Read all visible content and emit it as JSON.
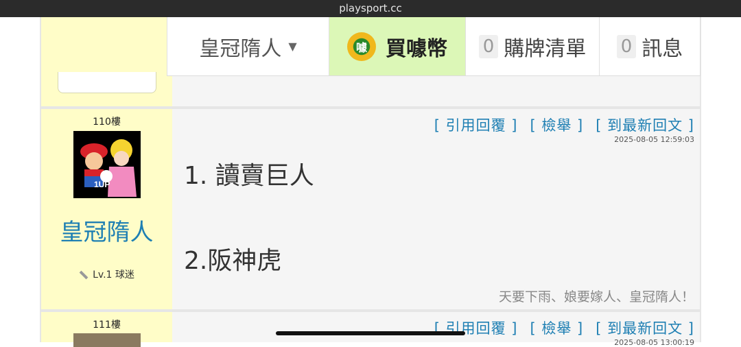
{
  "browser": {
    "url": "playsport.cc"
  },
  "nav": {
    "user_label": "皇冠隋人",
    "coin_icon_text": "噱",
    "coin_label": "買噱幣",
    "cart_count": "0",
    "cart_label": "購牌清單",
    "msg_count": "0",
    "msg_label": "訊息"
  },
  "posts": [
    {
      "floor": "110樓",
      "author": "皇冠隋人",
      "avatar_badge": "1UP",
      "level": "Lv.1",
      "title": "球迷",
      "actions": {
        "quote": "[ 引用回覆 ]",
        "report": "[ 檢舉 ]",
        "latest": "[ 到最新回文 ]"
      },
      "timestamp": "2025-08-05 12:59:03",
      "content": [
        "1. 讀賣巨人",
        "2.阪神虎"
      ],
      "signature": "天要下雨、娘要嫁人、皇冠隋人！"
    },
    {
      "floor": "111樓",
      "actions": {
        "quote": "[ 引用回覆 ]",
        "report": "[ 檢舉 ]",
        "latest": "[ 到最新回文 ]"
      },
      "timestamp": "2025-08-05 13:00:19"
    }
  ],
  "colors": {
    "link": "#1e7fb3",
    "sidebar_bg": "#fffdc8",
    "coin_bg": "#dcf7b7"
  }
}
